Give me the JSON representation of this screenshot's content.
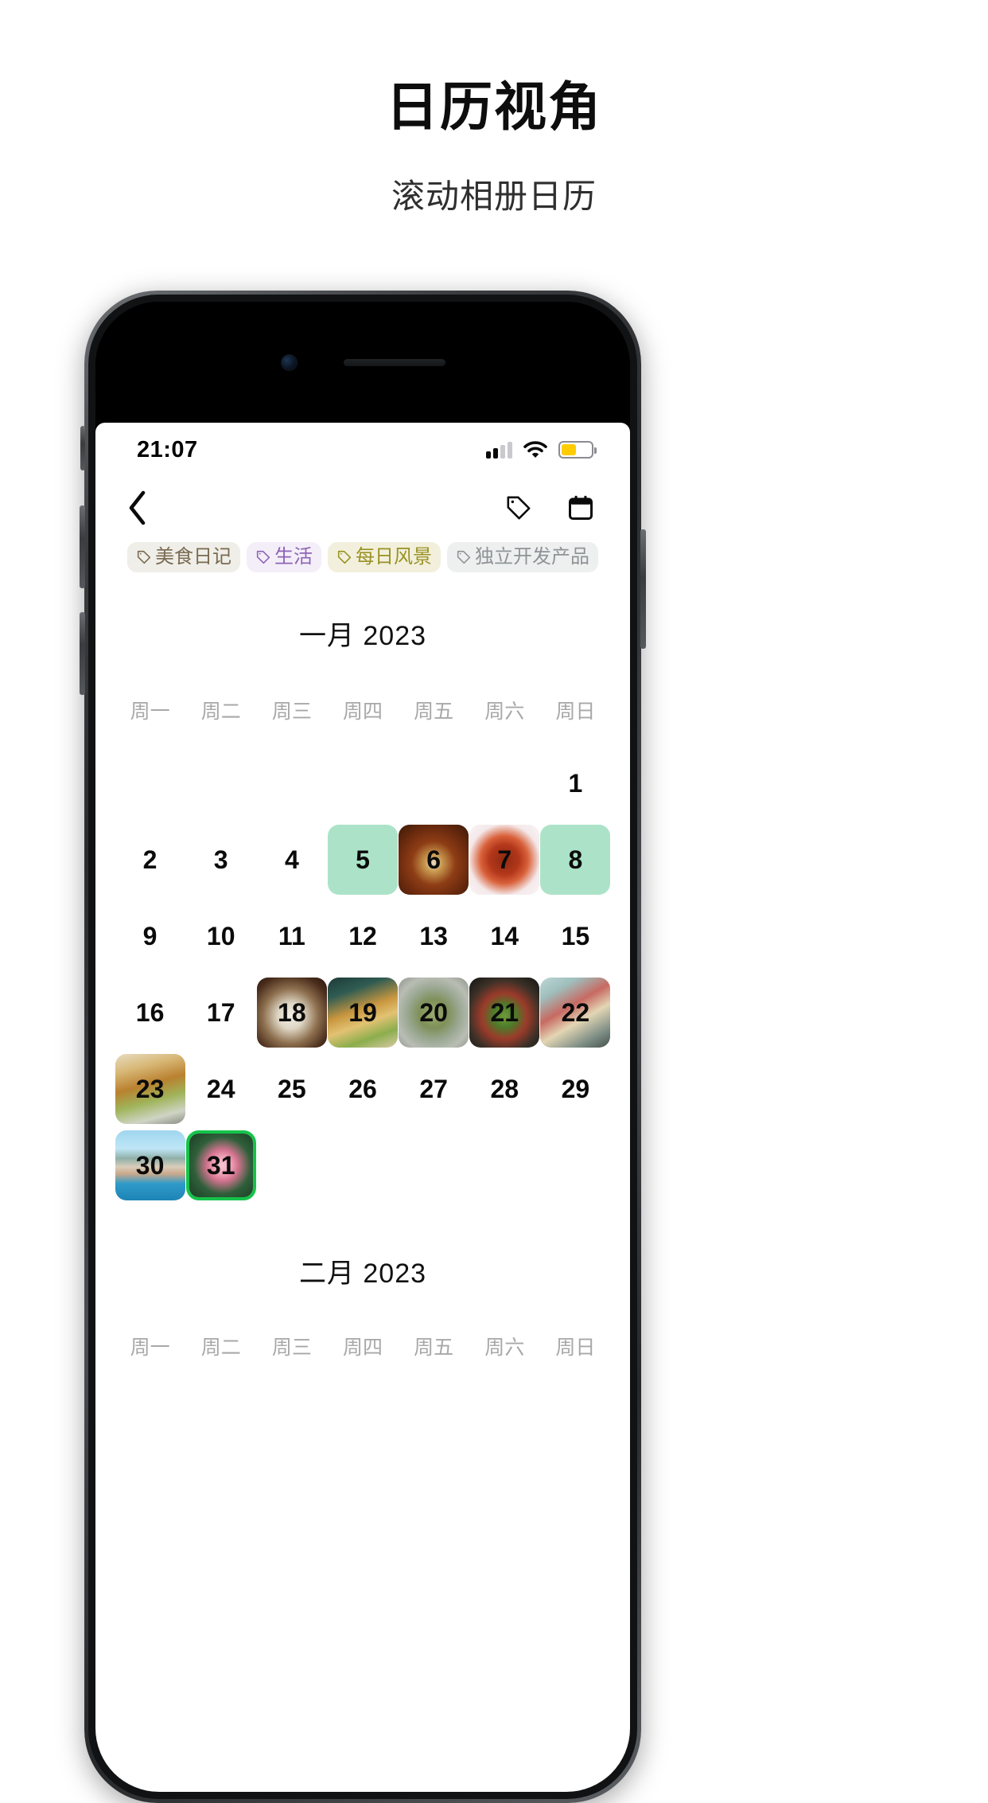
{
  "promo": {
    "title": "日历视角",
    "subtitle": "滚动相册日历"
  },
  "status_bar": {
    "time": "21:07",
    "signal_icon": "signal-bars-icon",
    "signal_bars_active": 2,
    "wifi_icon": "wifi-icon",
    "battery_icon": "battery-icon",
    "battery_level_percent": 50,
    "battery_color": "#FFCC00"
  },
  "navbar": {
    "back_icon": "chevron-left-icon",
    "tag_icon": "tag-icon",
    "calendar_icon": "calendar-icon"
  },
  "tags": [
    {
      "label": "美食日记",
      "color": "#7a6a52",
      "bg": "#efeee8",
      "icon": "tag-icon"
    },
    {
      "label": "生活",
      "color": "#8d64b5",
      "bg": "#f4eef9",
      "icon": "tag-icon"
    },
    {
      "label": "每日风景",
      "color": "#9a9124",
      "bg": "#f2f0dc",
      "icon": "tag-icon"
    },
    {
      "label": "独立开发产品",
      "color": "#8e9396",
      "bg": "#eef0f0",
      "icon": "tag-icon"
    }
  ],
  "weekdays": [
    "周一",
    "周二",
    "周三",
    "周四",
    "周五",
    "周六",
    "周日"
  ],
  "months": [
    {
      "title": "一月 2023",
      "leading_blanks": 6,
      "days": [
        {
          "n": "1",
          "style": "plain"
        },
        {
          "n": "2",
          "style": "plain"
        },
        {
          "n": "3",
          "style": "plain"
        },
        {
          "n": "4",
          "style": "plain"
        },
        {
          "n": "5",
          "style": "mint"
        },
        {
          "n": "6",
          "style": "photo",
          "photo": "noodle-soup"
        },
        {
          "n": "7",
          "style": "photo",
          "photo": "braised-chicken"
        },
        {
          "n": "8",
          "style": "mint"
        },
        {
          "n": "9",
          "style": "plain"
        },
        {
          "n": "10",
          "style": "plain"
        },
        {
          "n": "11",
          "style": "plain"
        },
        {
          "n": "12",
          "style": "plain"
        },
        {
          "n": "13",
          "style": "plain"
        },
        {
          "n": "14",
          "style": "plain"
        },
        {
          "n": "15",
          "style": "plain"
        },
        {
          "n": "16",
          "style": "plain"
        },
        {
          "n": "17",
          "style": "plain"
        },
        {
          "n": "18",
          "style": "photo",
          "photo": "dumplings-plate"
        },
        {
          "n": "19",
          "style": "photo",
          "photo": "burger-fries"
        },
        {
          "n": "20",
          "style": "photo",
          "photo": "green-buns"
        },
        {
          "n": "21",
          "style": "photo",
          "photo": "stirfry-pot"
        },
        {
          "n": "22",
          "style": "photo",
          "photo": "table-spread"
        },
        {
          "n": "23",
          "style": "photo",
          "photo": "sandwich-wrap"
        },
        {
          "n": "24",
          "style": "plain"
        },
        {
          "n": "25",
          "style": "plain"
        },
        {
          "n": "26",
          "style": "plain"
        },
        {
          "n": "27",
          "style": "plain"
        },
        {
          "n": "28",
          "style": "plain"
        },
        {
          "n": "29",
          "style": "plain"
        },
        {
          "n": "30",
          "style": "photo",
          "photo": "venice-harbor"
        },
        {
          "n": "31",
          "style": "photo",
          "photo": "pink-flower",
          "selected": true
        }
      ]
    },
    {
      "title": "二月 2023",
      "leading_blanks": 0,
      "days": []
    }
  ]
}
